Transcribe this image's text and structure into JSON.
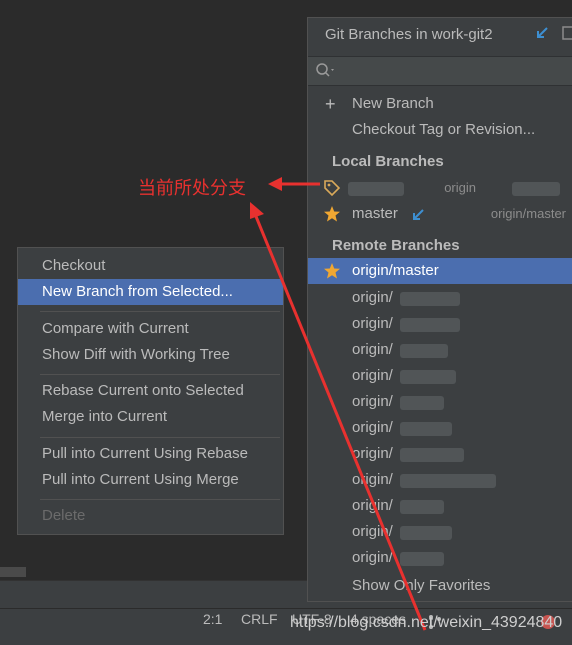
{
  "popup": {
    "title": "Git Branches in work-git2",
    "actions": {
      "new_branch": "New Branch",
      "checkout_tag": "Checkout Tag or Revision..."
    },
    "local_header": "Local Branches",
    "local": [
      {
        "name": "",
        "tracking": "origin"
      },
      {
        "name": "master",
        "tracking": "origin/master"
      }
    ],
    "remote_header": "Remote Branches",
    "remote": [
      "origin/master",
      "origin/",
      "origin/",
      "origin/",
      "origin/",
      "origin/",
      "origin/",
      "origin/",
      "origin/",
      "origin/",
      "origin/",
      "origin/"
    ],
    "footer": "Show Only Favorites"
  },
  "context_menu": {
    "items": [
      "Checkout",
      "New Branch from Selected...",
      "Compare with Current",
      "Show Diff with Working Tree",
      "Rebase Current onto Selected",
      "Merge into Current",
      "Pull into Current Using Rebase",
      "Pull into Current Using Merge",
      "Delete"
    ]
  },
  "annotation": "当前所处分支",
  "status_bar": {
    "position": "2:1",
    "line_sep": "CRLF",
    "encoding": "UTF-8",
    "indent": "4 spaces"
  },
  "watermark": "https://blog.csdn.net/weixin_43924840",
  "colors": {
    "selection": "#4b6eaf",
    "annotation": "#e8312f",
    "star": "#f0a732",
    "tag": "#d9a95a"
  }
}
